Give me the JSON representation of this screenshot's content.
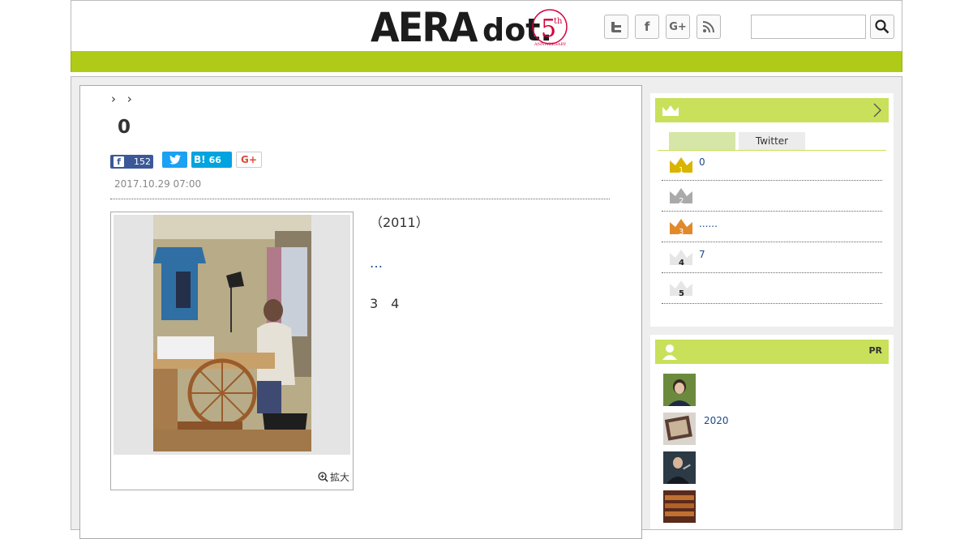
{
  "header": {
    "logo_text": "AERA",
    "logo_dot": "dot.",
    "anniversary_number": "5",
    "anniversary_suffix": "th",
    "anniversary_word": "ANNIVERSARY",
    "social": [
      "twitter-icon",
      "facebook-icon",
      "google-plus-icon",
      "rss-icon"
    ],
    "search_placeholder": "",
    "nav_color": "#b0cb17"
  },
  "article": {
    "breadcrumbs": [
      "›",
      "›"
    ],
    "title": "0",
    "share": {
      "facebook_count": "152",
      "hatena_label": "B!",
      "hatena_count": "66",
      "gplus_label": "G+"
    },
    "date": "2017.10.29 07:00",
    "photo_zoom_label": "拡大",
    "paragraphs": [
      "（2011）",
      "",
      "",
      ""
    ],
    "link_text": "…",
    "inline_numbers": "3　4"
  },
  "sidebar": {
    "tabs": [
      "",
      "Twitter"
    ],
    "ranking": [
      {
        "rank": "1",
        "text": "0",
        "color": "#d9b400"
      },
      {
        "rank": "2",
        "text": "",
        "color": "#aaaaaa"
      },
      {
        "rank": "3",
        "text": "......",
        "color": "#e08a2c"
      },
      {
        "rank": "4",
        "text": "7",
        "color": "#e0e0e0"
      },
      {
        "rank": "5",
        "text": "",
        "color": "#e0e0e0"
      }
    ],
    "pr_label": "PR",
    "pr_items": [
      {
        "text": ""
      },
      {
        "text": "2020"
      },
      {
        "text": ""
      },
      {
        "text": ""
      }
    ],
    "accent_color": "#c9e05a"
  }
}
